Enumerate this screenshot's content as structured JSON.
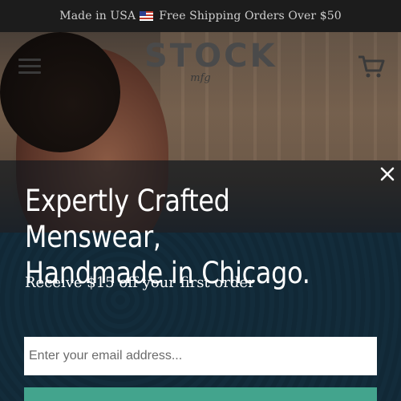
{
  "announcement": {
    "text_before_flag": "Made in USA",
    "text_after_flag": "Free Shipping Orders Over $50"
  },
  "header": {
    "logo_word": "STOCK",
    "logo_sub": "mfg",
    "icons": [
      "menu-icon",
      "cart-icon"
    ]
  },
  "popup": {
    "headline_line1": "Expertly Crafted Menswear,",
    "headline_line2": "Handmade in Chicago.",
    "offer": "Receive $15 off your first order",
    "email_placeholder": "Enter your email address...",
    "close_icon": "close-icon",
    "accent_color": "#43a48d"
  }
}
